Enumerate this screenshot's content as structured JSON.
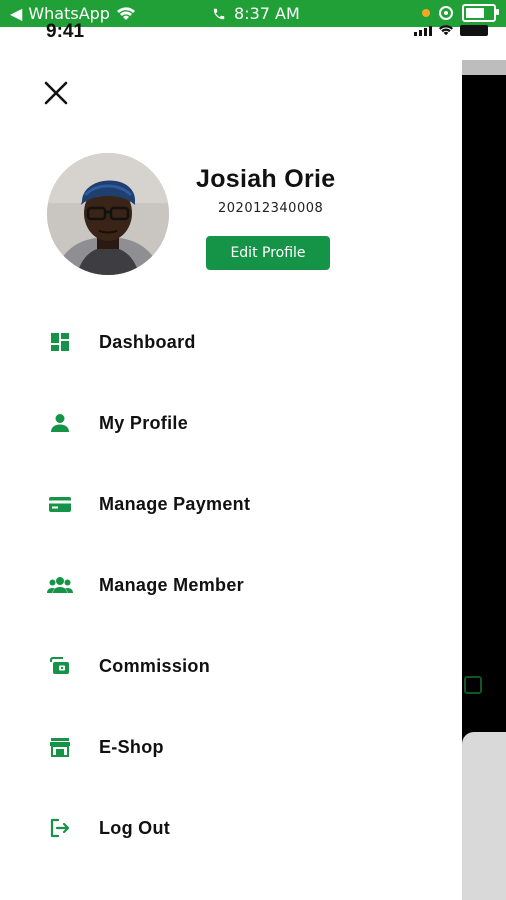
{
  "android_status": {
    "app": "WhatsApp",
    "time": "8:37 AM"
  },
  "ios_status": {
    "time": "9:41"
  },
  "profile": {
    "name": "Josiah Orie",
    "id": "202012340008",
    "edit_label": "Edit Profile"
  },
  "menu": {
    "items": [
      {
        "label": "Dashboard",
        "icon": "dashboard-icon"
      },
      {
        "label": "My Profile",
        "icon": "person-icon"
      },
      {
        "label": "Manage Payment",
        "icon": "credit-card-icon"
      },
      {
        "label": "Manage Member",
        "icon": "group-icon"
      },
      {
        "label": "Commission",
        "icon": "wallet-icon"
      },
      {
        "label": "E-Shop",
        "icon": "store-icon"
      },
      {
        "label": "Log Out",
        "icon": "logout-icon"
      }
    ]
  },
  "colors": {
    "accent": "#159447",
    "android_bar": "#21a038"
  }
}
